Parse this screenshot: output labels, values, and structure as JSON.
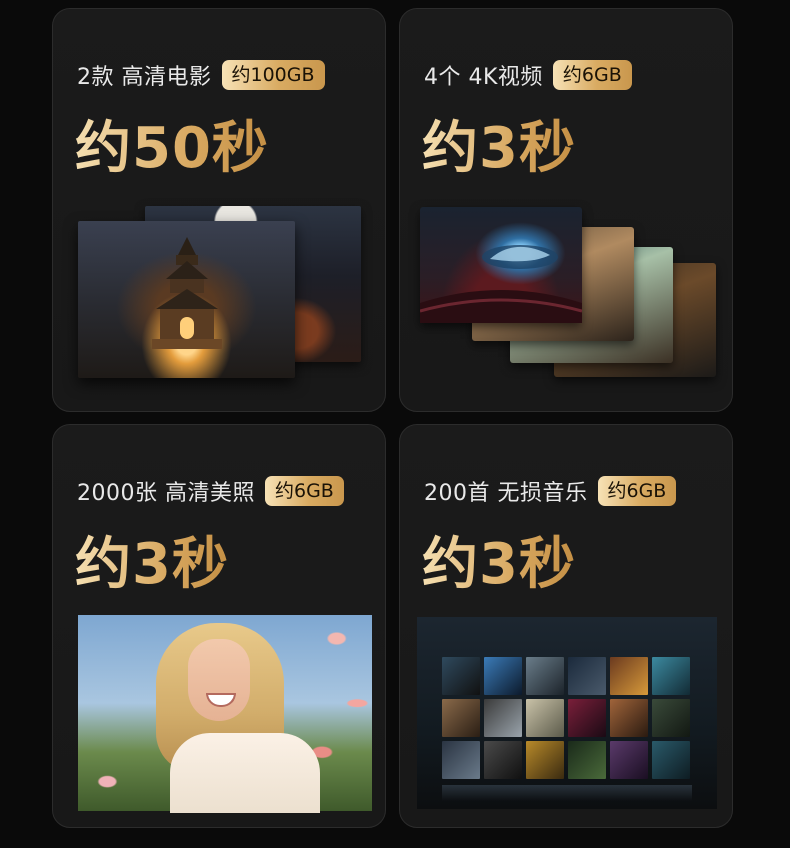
{
  "cards": [
    {
      "label": "2款 高清电影",
      "size": "约100GB",
      "time": "约50秒"
    },
    {
      "label": "4个 4K视频",
      "size": "约6GB",
      "time": "约3秒"
    },
    {
      "label": "2000张 高清美照",
      "size": "约6GB",
      "time": "约3秒"
    },
    {
      "label": "200首 无损音乐",
      "size": "约6GB",
      "time": "约3秒"
    }
  ],
  "colors": {
    "gold_light": "#f5dfb1",
    "gold_dark": "#c48f44",
    "card_bg": "#1b1b1b",
    "page_bg": "#0a0a0a"
  }
}
